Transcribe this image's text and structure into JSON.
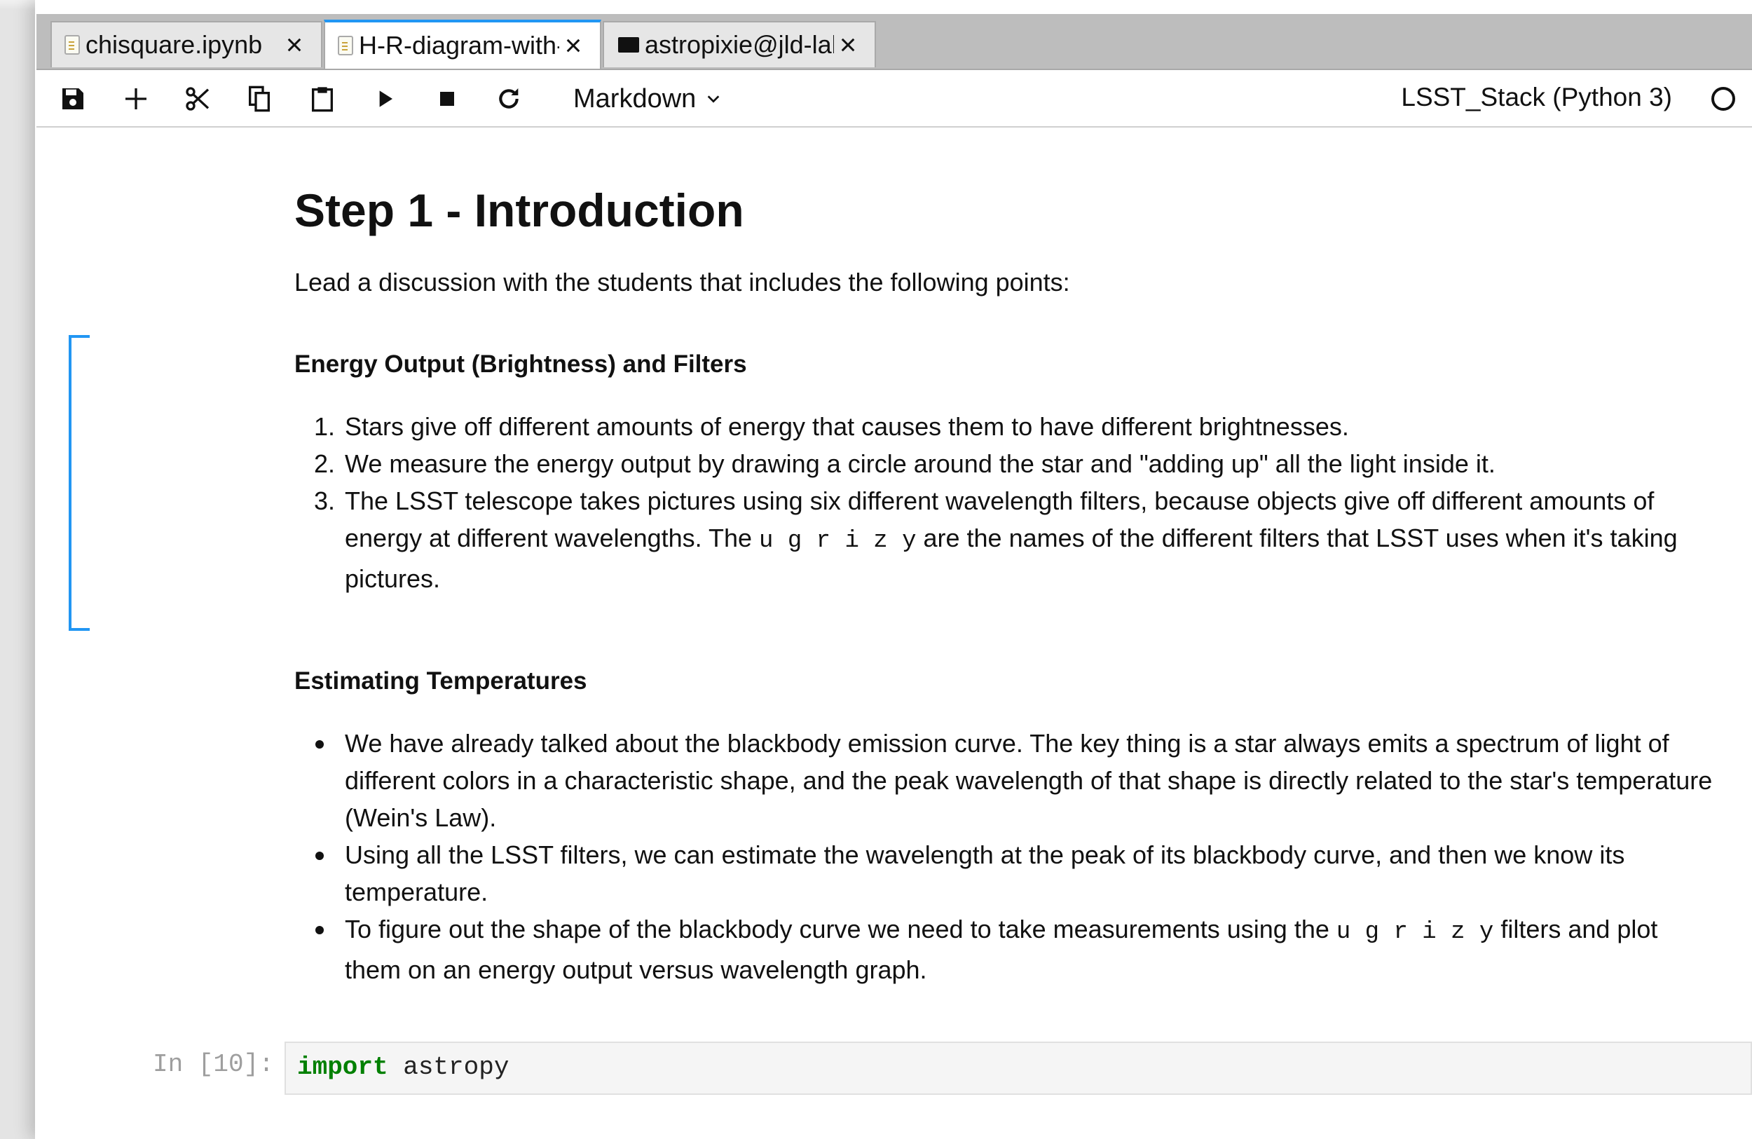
{
  "tabs": [
    {
      "label": "chisquare.ipynb",
      "close": "×",
      "icon": "notebook-file-icon"
    },
    {
      "label": "H-R-diagram-with-LSST",
      "close": "×",
      "icon": "notebook-file-icon"
    },
    {
      "label": "astropixie@jld-lab",
      "close": "×",
      "icon": "terminal-icon"
    }
  ],
  "toolbar": {
    "icons": [
      "save-icon",
      "plus-icon",
      "scissors-icon",
      "copy-icon",
      "paste-icon",
      "run-icon",
      "stop-icon",
      "restart-icon"
    ],
    "cell_type": "Markdown",
    "kernel_name": "LSST_Stack (Python 3)"
  },
  "markdown": {
    "title": "Step 1 - Introduction",
    "intro": "Lead a discussion with the students that includes the following points:",
    "section1_heading": "Energy Output (Brightness) and Filters",
    "section1_items": [
      {
        "num": "1.",
        "line1": "Stars give off different amounts of energy that causes them to have different brightnesses."
      },
      {
        "num": "2.",
        "line1": "We measure the energy output by drawing a circle around the star and \"adding up\" all the light inside it."
      },
      {
        "num": "3.",
        "line1": "The LSST telescope takes pictures using six different wavelength filters, because objects give off different amounts of",
        "line2_pre": "energy at different wavelengths. The ",
        "line2_code": "u g r i z y",
        "line2_post": " are the names of the different filters that LSST uses when it's taking",
        "line3": "pictures."
      }
    ],
    "section2_heading": "Estimating Temperatures",
    "section2_items": [
      {
        "line1": "We have already talked about the blackbody emission curve. The key thing is a star always emits a spectrum of light of",
        "line2": "different colors in a characteristic shape, and the peak wavelength of that shape is directly related to the star's temperature",
        "line3": "(Wein's Law)."
      },
      {
        "line1": "Using all the LSST filters, we can estimate the wavelength at the peak of its blackbody curve, and then we know its",
        "line2": "temperature."
      },
      {
        "line1_pre": "To figure out the shape of the blackbody curve we need to take measurements using the ",
        "line1_code": "u g r i z y",
        "line1_post": " filters and plot",
        "line2": "them on an energy output versus wavelength graph."
      }
    ]
  },
  "code_cell": {
    "prompt": "In [10]:",
    "keyword": "import",
    "rest": " astropy"
  },
  "colors": {
    "accent": "#2196f3",
    "keyword": "#008000"
  }
}
